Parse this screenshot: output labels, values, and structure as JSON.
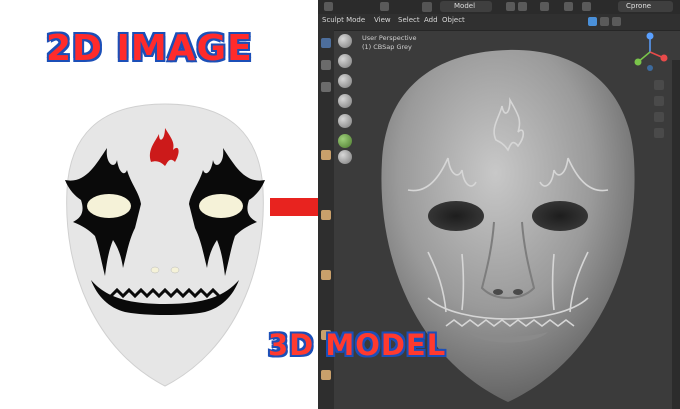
{
  "labels": {
    "left_title": "2D IMAGE",
    "right_title": "3D MODEL"
  },
  "blender": {
    "menu": [
      "Sculpt Mode",
      "View",
      "Select",
      "Add",
      "Object"
    ],
    "mode": "Model",
    "scene": "Cprone",
    "viewport_title": "User Perspective",
    "viewport_object": "(1) CBSap Grey"
  },
  "colors": {
    "title_fill": "#ff2b2b",
    "title_outline": "#1b4fb8",
    "arrow": "#e8231f",
    "mask_face": "#e6e6e6",
    "paint_black": "#0a0a0a",
    "paint_red": "#cc1a1a",
    "viewport_bg": "#3b3b3b",
    "clay": "#9a9a9a"
  },
  "icons": [
    "arrow-right-icon",
    "sculpt-brush-icon",
    "navigation-gizmo-icon",
    "zoom-icon",
    "hand-pan-icon",
    "camera-icon",
    "grid-icon"
  ]
}
